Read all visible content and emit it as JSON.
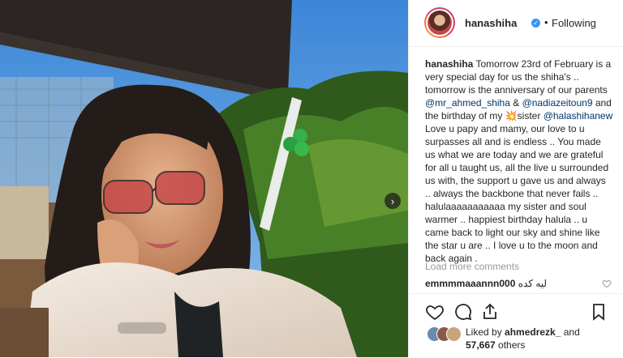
{
  "post": {
    "username": "hanashiha",
    "verified_icon": "verified-icon",
    "dot": "•",
    "follow_status": "Following",
    "caption_username": "hanashiha",
    "caption_p1": " Tomorrow 23rd of February is a very special day for us the shiha's .. tomorrow is the anniversary of our parents ",
    "mention1": "@mr_ahmed_shiha",
    "caption_p2": " & ",
    "mention2": "@nadiazeitoun9",
    "caption_p3": " and the birthday of my ",
    "sparkle_emoji": "💥",
    "caption_p4": "sister ",
    "mention3": "@halashihanew",
    "caption_p5": " Love u papy and mamy, our love to u surpasses all and is endless .. You made us what we are today and we are grateful for all u taught us, all the live u surrounded us with, the support u gave us and always .. always the backbone that never fails .. halulaaaaaaaaaaa my sister and soul warmer .. happiest birthday halula .. u came back to light our sky and shine like the star u are .. I love u to the moon and back again ."
  },
  "comments": {
    "load_more": "Load more comments",
    "items": [
      {
        "user": "emmmmaaannn000",
        "text": "ليه كده"
      }
    ]
  },
  "likes": {
    "liked_by_prefix": "Liked by ",
    "liked_by_user": "ahmedrezk_",
    "liked_by_and": " and",
    "count": "57,667",
    "count_suffix": " others"
  },
  "timestamp": "",
  "colors": {
    "accent": "#3897f0",
    "mention": "#003569",
    "muted": "#999999",
    "border": "#efefef"
  }
}
